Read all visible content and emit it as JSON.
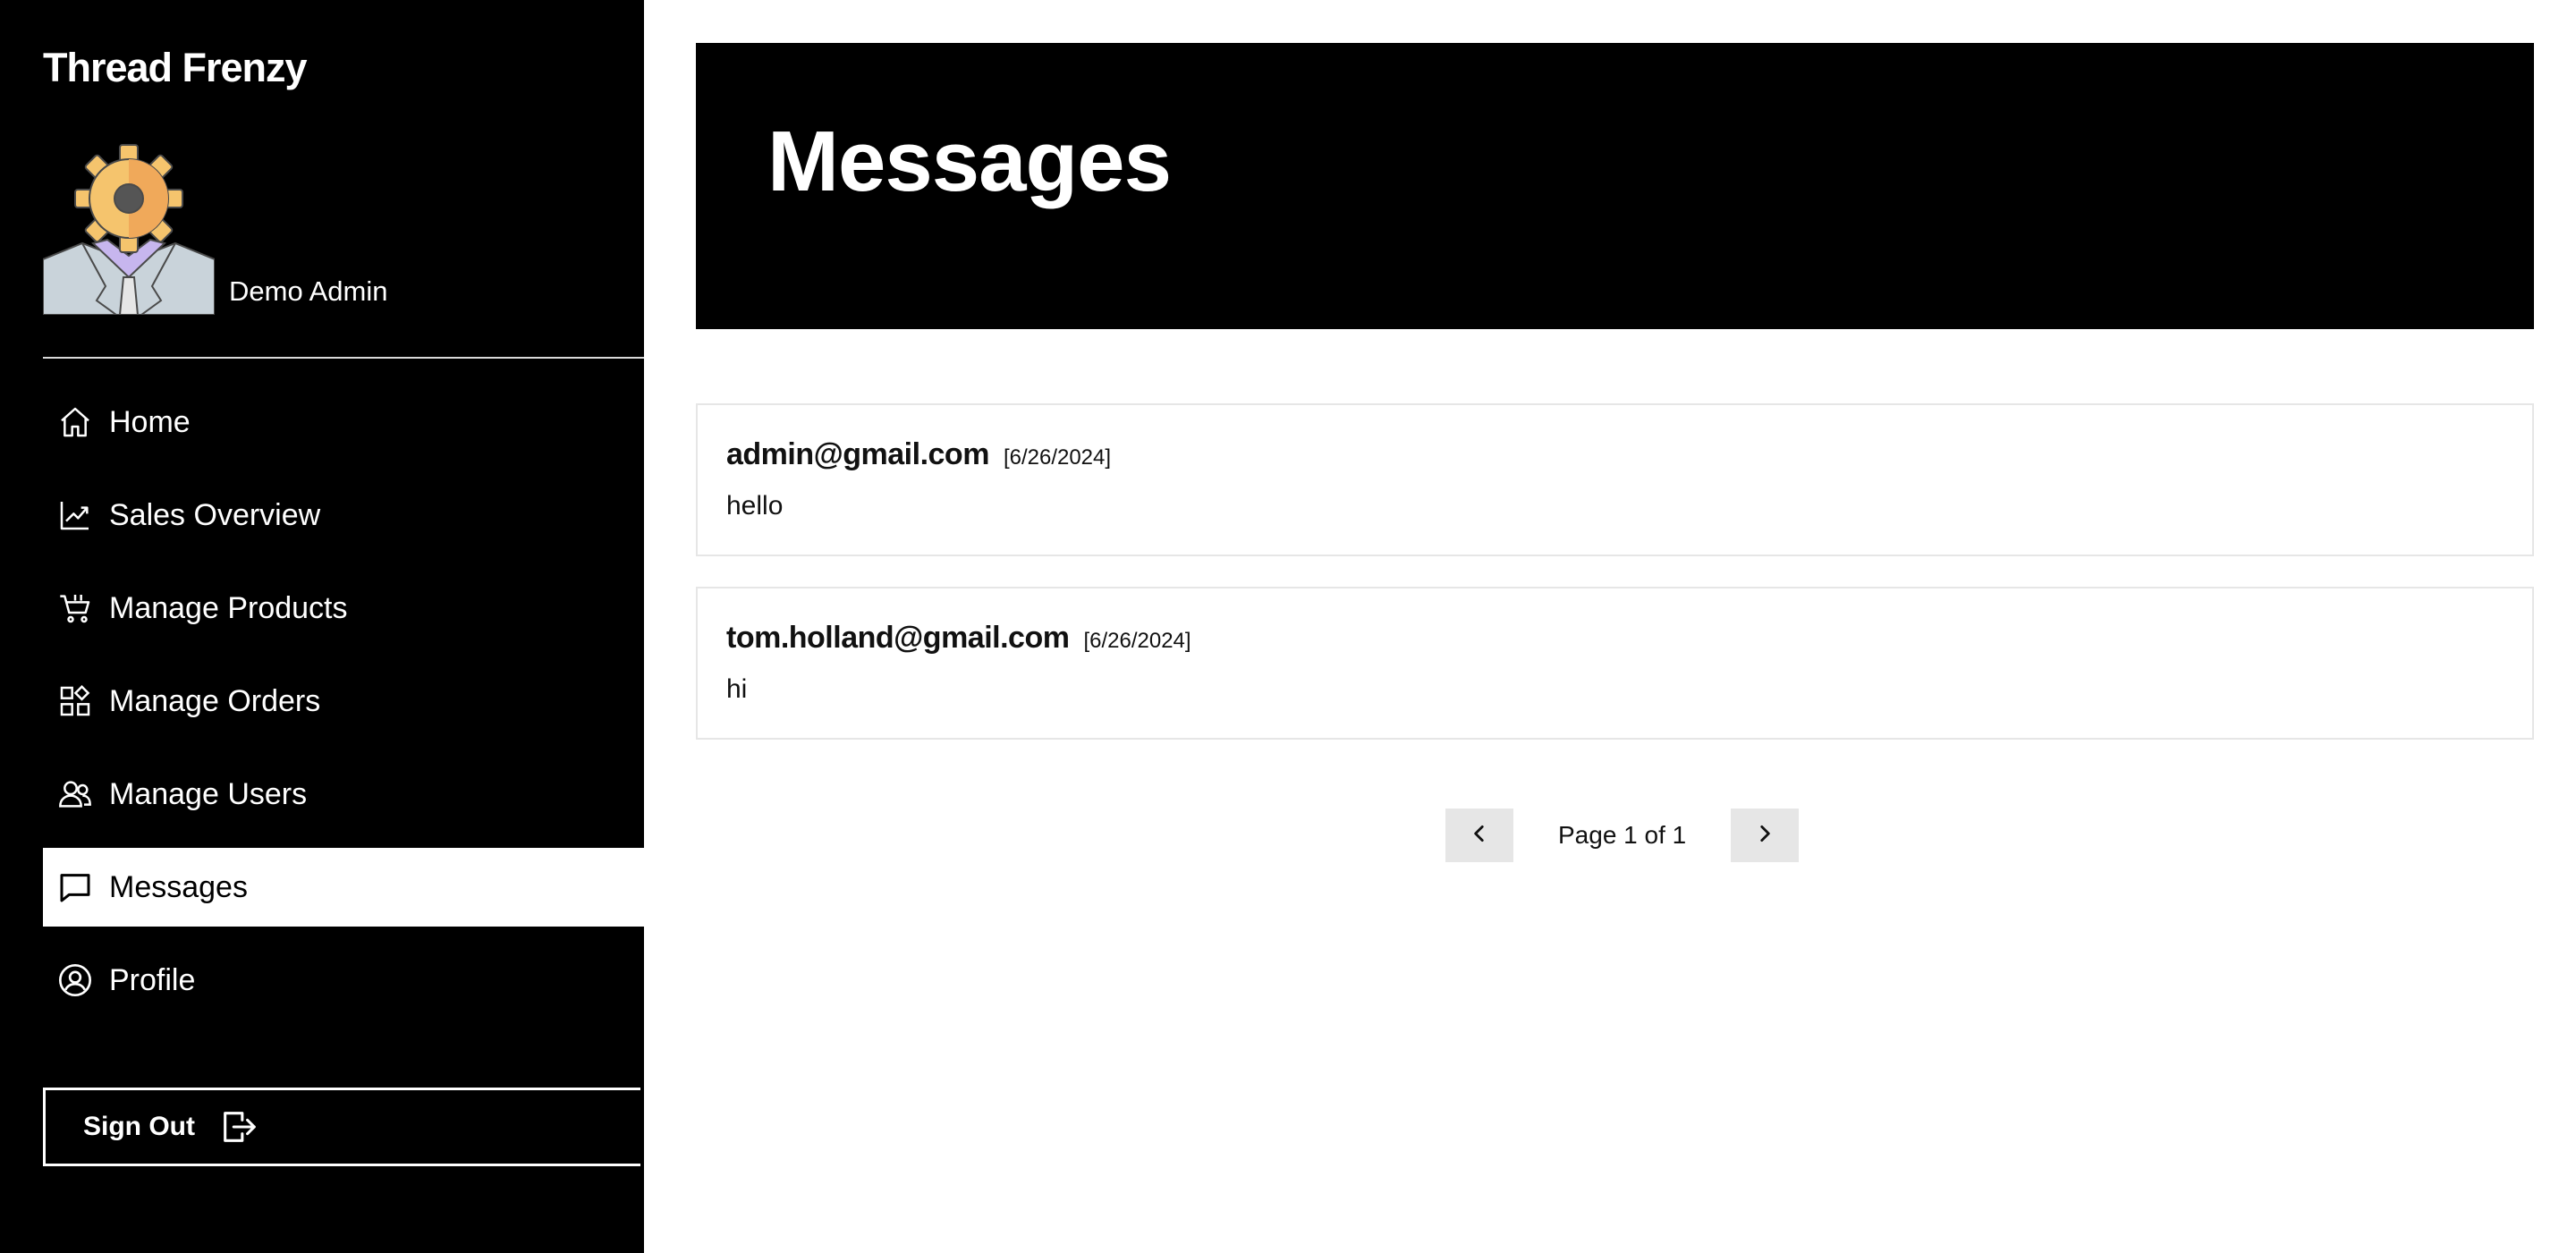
{
  "brand": "Thread Frenzy",
  "user": {
    "name": "Demo Admin"
  },
  "nav": {
    "items": [
      {
        "label": "Home",
        "icon": "home-icon"
      },
      {
        "label": "Sales Overview",
        "icon": "chart-line-icon"
      },
      {
        "label": "Manage Products",
        "icon": "cart-icon"
      },
      {
        "label": "Manage Orders",
        "icon": "grid-icon"
      },
      {
        "label": "Manage Users",
        "icon": "users-icon"
      },
      {
        "label": "Messages",
        "icon": "message-icon",
        "active": true
      },
      {
        "label": "Profile",
        "icon": "user-circle-icon"
      }
    ],
    "signout": {
      "label": "Sign Out",
      "icon": "sign-out-icon"
    }
  },
  "page": {
    "title": "Messages"
  },
  "messages": [
    {
      "email": "admin@gmail.com",
      "date": "[6/26/2024]",
      "body": "hello"
    },
    {
      "email": "tom.holland@gmail.com",
      "date": "[6/26/2024]",
      "body": "hi"
    }
  ],
  "pagination": {
    "text": "Page 1 of 1",
    "prev_icon": "chevron-left-icon",
    "next_icon": "chevron-right-icon"
  },
  "colors": {
    "sidebar_bg": "#000000",
    "hero_bg": "#000000",
    "active_bg": "#ffffff",
    "pager_btn_bg": "#e6e6e6",
    "card_border": "#e6e6e6"
  }
}
